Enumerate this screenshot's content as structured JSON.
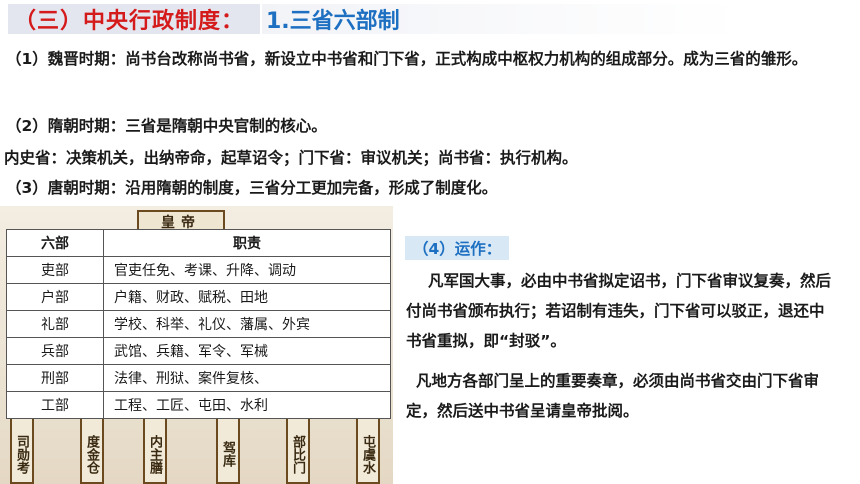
{
  "header": {
    "section_title": "（三）中央行政制度：",
    "subsection_title": "1.三省六部制"
  },
  "paragraphs": {
    "p1": "（1）魏晋时期：尚书台改称尚书省，新设立中书省和门下省，正式构成中枢权力机构的组成部分。成为三省的雏形。",
    "p2": "（2）隋朝时期：三省是隋朝中央官制的核心。",
    "p3": "内史省：决策机关，出纳帝命，起草诏令；门下省：审议机关；尚书省：执行机构。",
    "p4": "（3）唐朝时期：沿用隋朝的制度，三省分工更加完备，形成了制度化。"
  },
  "diagram": {
    "emperor": "皇帝",
    "bottom_columns": [
      "司勋考",
      "度金仓",
      "内主膳",
      "驾库",
      "部比门",
      "屯虞水"
    ]
  },
  "table": {
    "headers": [
      "六部",
      "职责"
    ],
    "rows": [
      {
        "dept": "吏部",
        "duty": "官吏任免、考课、升降、调动"
      },
      {
        "dept": "户部",
        "duty": "户籍、财政、赋税、田地"
      },
      {
        "dept": "礼部",
        "duty": "学校、科举、礼仪、藩属、外宾"
      },
      {
        "dept": "兵部",
        "duty": "武馆、兵籍、军令、军械"
      },
      {
        "dept": "刑部",
        "duty": "法律、刑狱、案件复核、"
      },
      {
        "dept": "工部",
        "duty": "工程、工匠、屯田、水利"
      }
    ]
  },
  "operation": {
    "title": "（4）运作：",
    "p1": "凡军国大事，必由中书省拟定诏书，门下省审议复奏，然后付尚书省颁布执行；若诏制有违失，门下省可以驳正，退还中书省重拟，即“封驳”。",
    "p2": "凡地方各部门呈上的重要奏章，必须由尚书省交由门下省审定，然后送中书省呈请皇帝批阅。"
  }
}
